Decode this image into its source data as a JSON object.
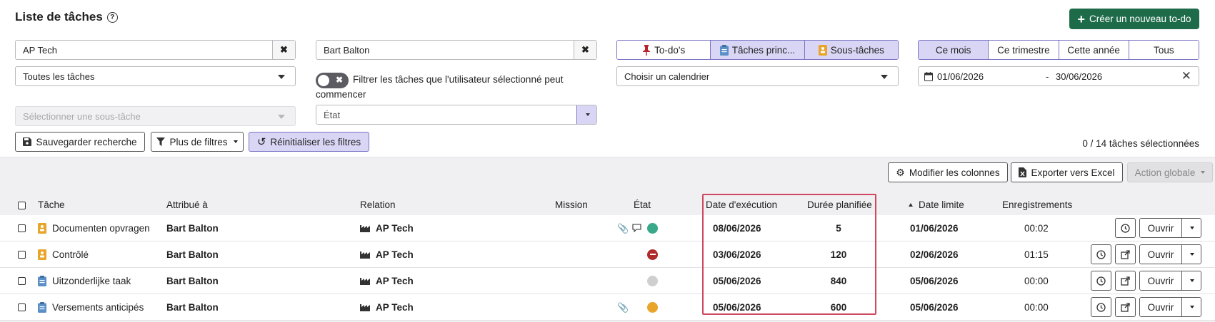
{
  "header": {
    "title": "Liste de tâches",
    "new_button": "Créer un nouveau to-do"
  },
  "filters": {
    "company": "AP Tech",
    "user": "Bart Balton",
    "task_scope": "Toutes les tâches",
    "toggle_label": "Filtrer les tâches que l'utilisateur sélectionné peut commencer",
    "subtask_placeholder": "Sélectionner une sous-tâche",
    "state_placeholder": "État",
    "calendar_placeholder": "Choisir un calendrier",
    "type_tabs": [
      "To-do's",
      "Tâches princ...",
      "Sous-tâches"
    ],
    "period_tabs": [
      "Ce mois",
      "Ce trimestre",
      "Cette année",
      "Tous"
    ],
    "date_from": "01/06/2026",
    "date_sep": "-",
    "date_to": "30/06/2026",
    "save_search": "Sauvegarder recherche",
    "more_filters": "Plus de filtres",
    "reset_filters": "Réinitialiser les filtres",
    "selection_count": "0 / 14 tâches sélectionnées"
  },
  "toolbar": {
    "modify_columns": "Modifier les colonnes",
    "export_excel": "Exporter vers Excel",
    "global_action": "Action globale"
  },
  "table": {
    "headers": {
      "task": "Tâche",
      "assigned": "Attribué à",
      "relation": "Relation",
      "mission": "Mission",
      "state": "État",
      "exec_date": "Date d'exécution",
      "planned": "Durée planifiée",
      "due": "Date limite",
      "records": "Enregistrements"
    },
    "open_label": "Ouvrir",
    "rows": [
      {
        "task": "Documenten opvragen",
        "icon": "subtask-icon",
        "assigned": "Bart Balton",
        "relation": "AP Tech",
        "attach": true,
        "comment": true,
        "state_color": "#3aa88a",
        "state": "green",
        "exec_date": "08/06/2026",
        "planned": "5",
        "due": "01/06/2026",
        "records": "00:02",
        "external": false
      },
      {
        "task": "Contrôlé",
        "icon": "subtask-icon",
        "assigned": "Bart Balton",
        "relation": "AP Tech",
        "attach": false,
        "comment": false,
        "state_color": "#b02a2a",
        "state": "blocked",
        "exec_date": "03/06/2026",
        "planned": "120",
        "due": "02/06/2026",
        "records": "01:15",
        "external": true
      },
      {
        "task": "Uitzonderlijke taak",
        "icon": "main-task-icon",
        "assigned": "Bart Balton",
        "relation": "AP Tech",
        "attach": false,
        "comment": false,
        "state_color": "#cfcfcf",
        "state": "grey",
        "exec_date": "05/06/2026",
        "planned": "840",
        "due": "05/06/2026",
        "records": "00:00",
        "external": true
      },
      {
        "task": "Versements anticipés",
        "icon": "main-task-icon",
        "assigned": "Bart Balton",
        "relation": "AP Tech",
        "attach": true,
        "comment": false,
        "state_color": "#e8a52a",
        "state": "orange",
        "exec_date": "05/06/2026",
        "planned": "600",
        "due": "05/06/2026",
        "records": "00:00",
        "external": true
      }
    ]
  },
  "colors": {
    "primary": "#1e6b4a",
    "accent": "#7a74c4",
    "highlight": "#d04860"
  }
}
